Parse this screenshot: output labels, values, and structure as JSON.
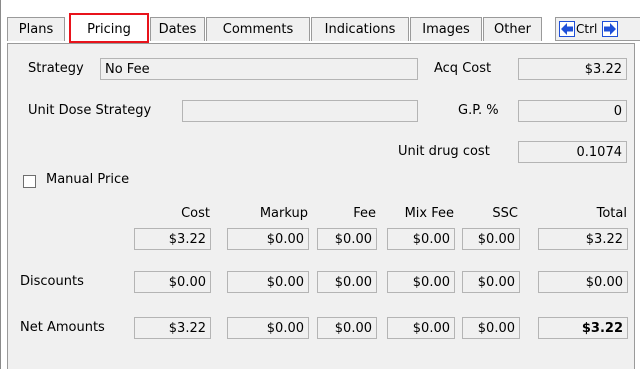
{
  "tabs": [
    {
      "label": "Plans",
      "ul": "a",
      "active": false
    },
    {
      "label": "Pricing",
      "ul": "i",
      "active": true
    },
    {
      "label": "Dates",
      "ul": "e",
      "active": false
    },
    {
      "label": "Comments",
      "ul": "C",
      "active": false
    },
    {
      "label": "Indications",
      "ul": "",
      "active": false
    },
    {
      "label": "Images",
      "ul": "",
      "active": false
    },
    {
      "label": "Other",
      "ul": "",
      "active": false
    }
  ],
  "nav": {
    "ctrl_label": "Ctrl",
    "left_icon": "arrow-left-icon",
    "right_icon": "arrow-right-icon",
    "arrow_color": "#1e4fd8"
  },
  "strategy": {
    "label": "Strategy",
    "value": "No Fee"
  },
  "unit_dose": {
    "label": "Unit Dose Strategy",
    "value": ""
  },
  "acq_cost": {
    "label": "Acq Cost",
    "value": "$3.22"
  },
  "gp": {
    "label": "G.P. %",
    "value": "0"
  },
  "unit_drug_cost": {
    "label": "Unit drug cost",
    "value": "0.1074"
  },
  "manual_price": {
    "label": "Manual Price",
    "checked": false
  },
  "columns": [
    "Cost",
    "Markup",
    "Fee",
    "Mix Fee",
    "SSC",
    "Total"
  ],
  "rows": [
    {
      "label": "",
      "values": [
        "$3.22",
        "$0.00",
        "$0.00",
        "$0.00",
        "$0.00",
        "$3.22"
      ]
    },
    {
      "label": "Discounts",
      "values": [
        "$0.00",
        "$0.00",
        "$0.00",
        "$0.00",
        "$0.00",
        "$0.00"
      ]
    },
    {
      "label": "Net Amounts",
      "values": [
        "$3.22",
        "$0.00",
        "$0.00",
        "$0.00",
        "$0.00",
        "$3.22"
      ]
    }
  ],
  "colors": {
    "active_tab_border": "#e8131b",
    "panel_bg": "#f0f0f0"
  }
}
